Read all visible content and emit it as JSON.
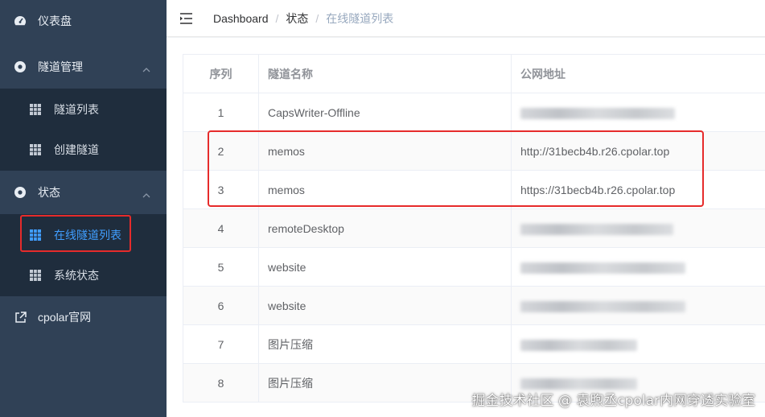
{
  "sidebar": {
    "dashboard": "仪表盘",
    "tunnel_mgmt": "隧道管理",
    "tunnel_list": "隧道列表",
    "create_tunnel": "创建隧道",
    "status": "状态",
    "online_tunnels": "在线隧道列表",
    "system_status": "系统状态",
    "website": "cpolar官网"
  },
  "breadcrumb": [
    "Dashboard",
    "状态",
    "在线隧道列表"
  ],
  "table": {
    "headers": [
      "序列",
      "隧道名称",
      "公网地址"
    ],
    "rows": [
      {
        "idx": "1",
        "name": "CapsWriter-Offline",
        "url": ""
      },
      {
        "idx": "2",
        "name": "memos",
        "url": "http://31becb4b.r26.cpolar.top"
      },
      {
        "idx": "3",
        "name": "memos",
        "url": "https://31becb4b.r26.cpolar.top"
      },
      {
        "idx": "4",
        "name": "remoteDesktop",
        "url": ""
      },
      {
        "idx": "5",
        "name": "website",
        "url": ""
      },
      {
        "idx": "6",
        "name": "website",
        "url": ""
      },
      {
        "idx": "7",
        "name": "图片压缩",
        "url": ""
      },
      {
        "idx": "8",
        "name": "图片压缩",
        "url": ""
      }
    ]
  },
  "watermark": "掘金技术社区 @ 袁煦丞cpolar内网穿透实验室",
  "colors": {
    "sidebar": "#304156",
    "submenu": "#1f2d3d",
    "accent": "#409eff",
    "highlight": "#e62b2b"
  }
}
